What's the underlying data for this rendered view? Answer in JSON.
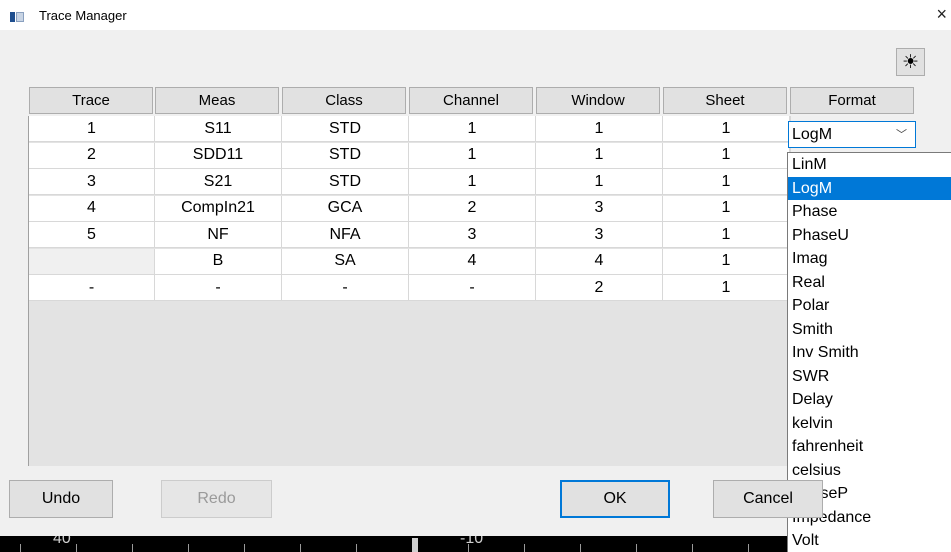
{
  "window": {
    "title": "Trace Manager",
    "close_glyph": "×"
  },
  "toolbar": {
    "sun_glyph": "☀"
  },
  "columns": [
    "Trace",
    "Meas",
    "Class",
    "Channel",
    "Window",
    "Sheet",
    "Format"
  ],
  "rows": [
    [
      "1",
      "S11",
      "STD",
      "1",
      "1",
      "1"
    ],
    [
      "2",
      "SDD11",
      "STD",
      "1",
      "1",
      "1"
    ],
    [
      "3",
      "S21",
      "STD",
      "1",
      "1",
      "1"
    ],
    [
      "4",
      "CompIn21",
      "GCA",
      "2",
      "3",
      "1"
    ],
    [
      "5",
      "NF",
      "NFA",
      "3",
      "3",
      "1"
    ],
    [
      "",
      "B",
      "SA",
      "4",
      "4",
      "1"
    ],
    [
      "-",
      "-",
      "-",
      "-",
      "2",
      "1"
    ]
  ],
  "format_dropdown": {
    "value": "LogM",
    "chevron": "﹀",
    "options": [
      "LinM",
      "LogM",
      "Phase",
      "PhaseU",
      "Imag",
      "Real",
      "Polar",
      "Smith",
      "Inv Smith",
      "SWR",
      "Delay",
      "kelvin",
      "fahrenheit",
      "celsius",
      "PhaseP",
      "Impedance",
      "Volt"
    ],
    "selected_index": 1
  },
  "buttons": {
    "undo": "Undo",
    "redo": "Redo",
    "ok": "OK",
    "cancel": "Cancel"
  },
  "background_strip": {
    "left_label": "40",
    "right_label": "-10"
  }
}
